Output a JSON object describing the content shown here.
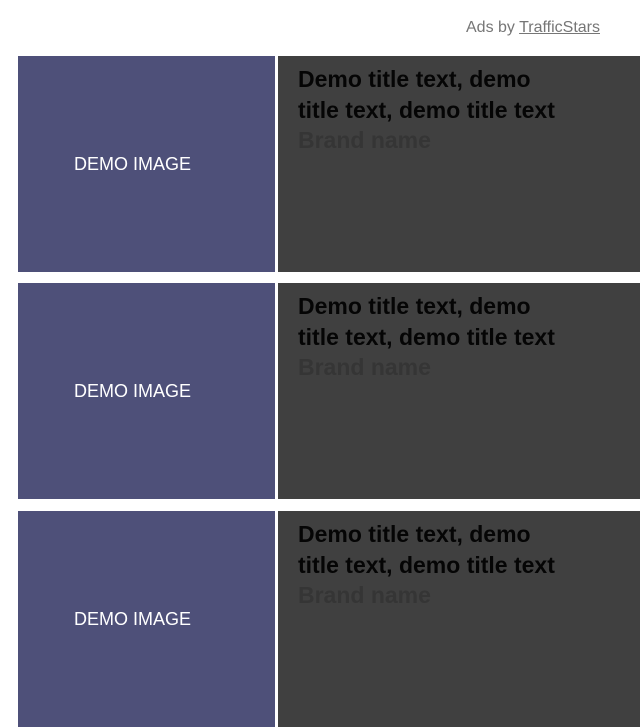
{
  "attribution": {
    "prefix": "Ads by ",
    "link_text": "TrafficStars"
  },
  "ads": [
    {
      "image_label": "DEMO IMAGE",
      "title_line1": "Demo title text, demo",
      "title_line2": "title text, demo title text",
      "brand": "Brand name"
    },
    {
      "image_label": "DEMO IMAGE",
      "title_line1": "Demo title text, demo",
      "title_line2": "title text, demo title text",
      "brand": "Brand name"
    },
    {
      "image_label": "DEMO IMAGE",
      "title_line1": "Demo title text, demo",
      "title_line2": "title text, demo title text",
      "brand": "Brand name"
    }
  ],
  "colors": {
    "image_bg": "#4e5079",
    "card_bg": "#404040",
    "title_text": "#050505",
    "brand_text": "#353535"
  }
}
